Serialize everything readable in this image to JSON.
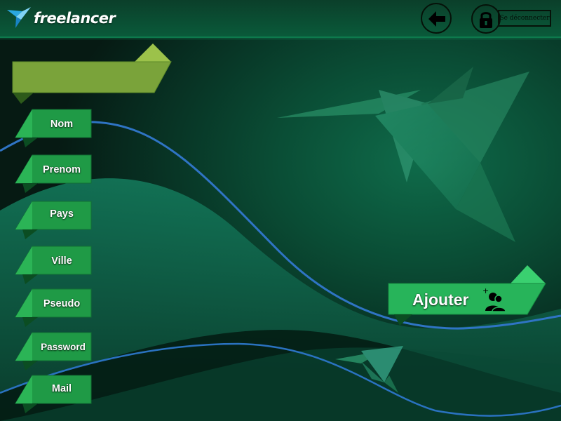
{
  "header": {
    "brand": "freelancer",
    "back_icon": "arrow-left-icon",
    "lock_icon": "lock-icon",
    "logout_label": "Se déconnecter"
  },
  "form": {
    "title_ribbon_text": "",
    "fields": [
      {
        "label": "Nom"
      },
      {
        "label": "Prenom"
      },
      {
        "label": "Pays"
      },
      {
        "label": "Ville"
      },
      {
        "label": "Pseudo"
      },
      {
        "label": "Password"
      },
      {
        "label": "Mail"
      }
    ]
  },
  "actions": {
    "add_label": "Ajouter",
    "add_icon": "add-user-icon"
  },
  "colors": {
    "ribbon_green": "#1e9a44",
    "title_ribbon": "#7aa83a",
    "accent_blue": "#3a7fc4",
    "background": "#0a4d35"
  }
}
